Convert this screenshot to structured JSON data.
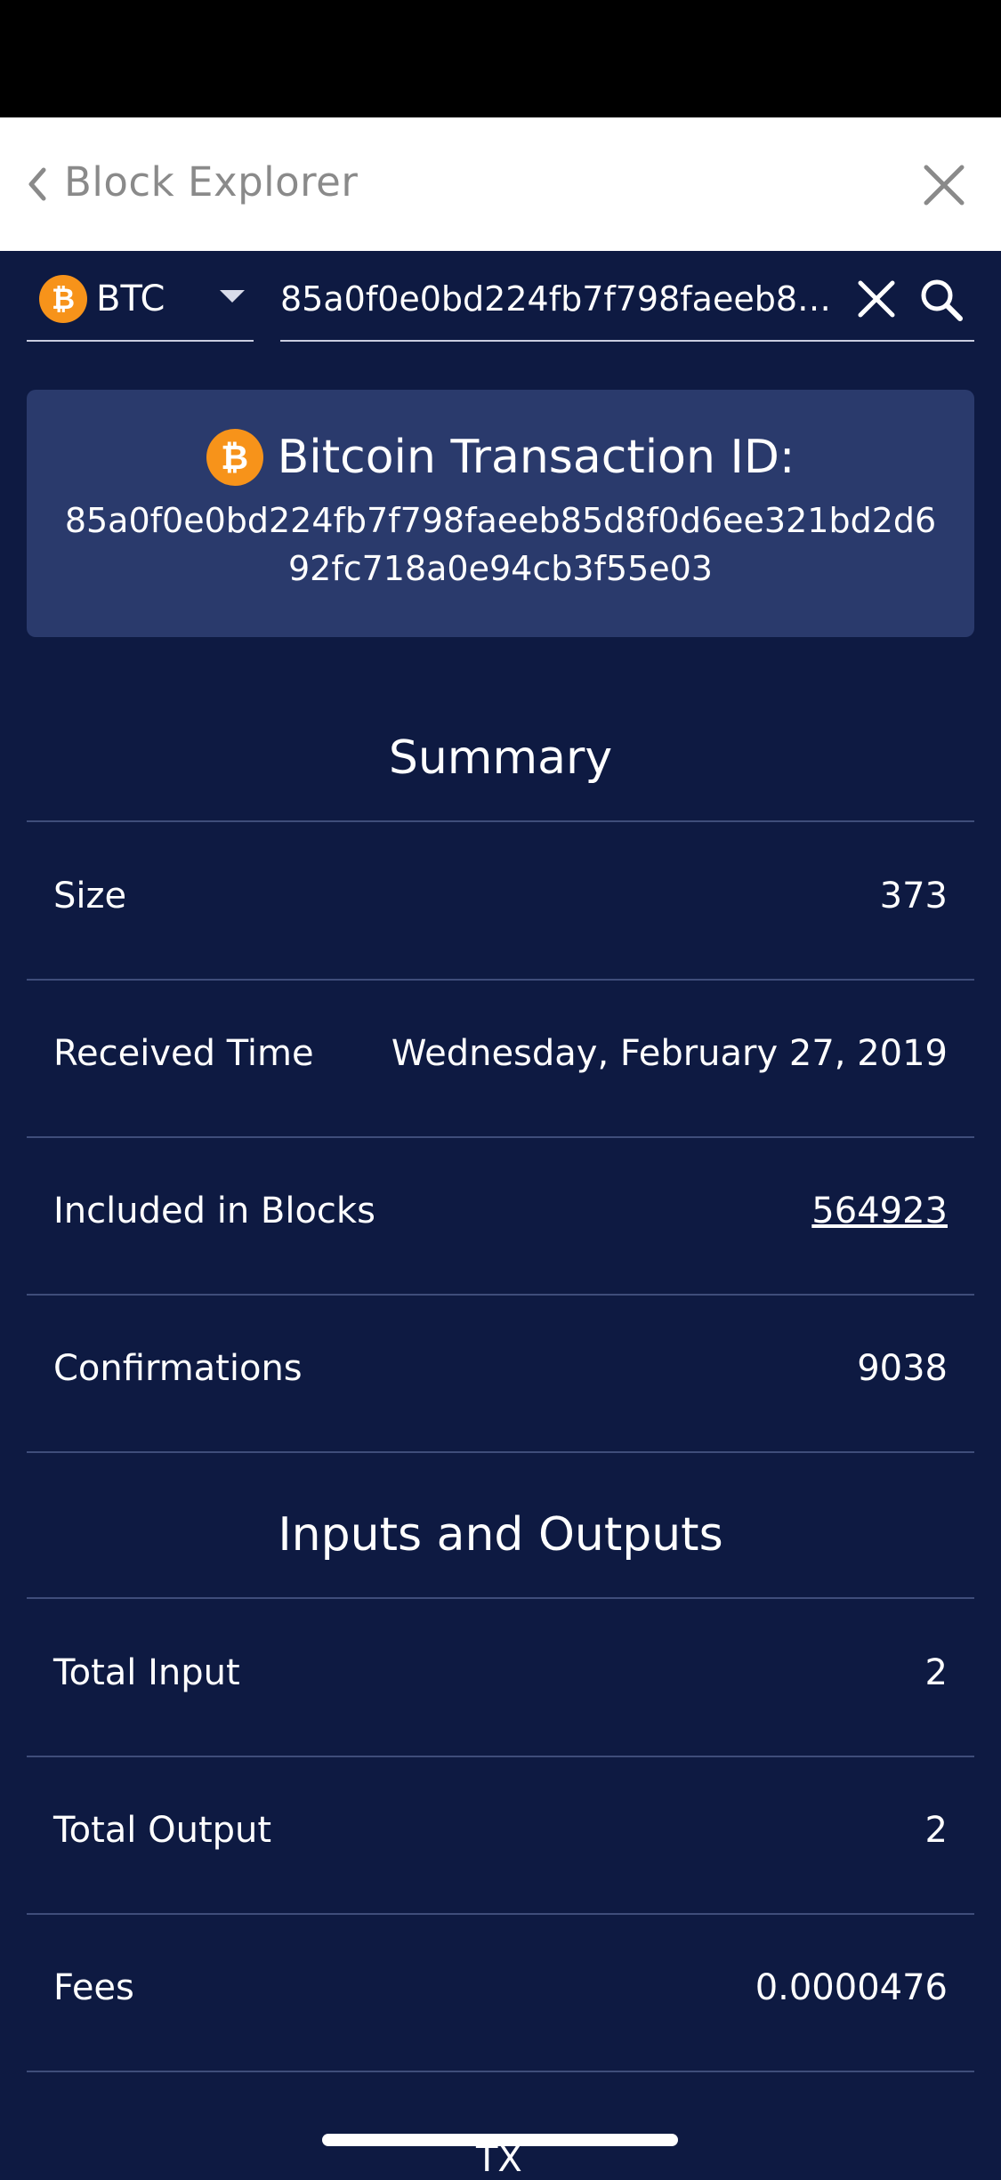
{
  "header": {
    "title": "Block Explorer"
  },
  "search": {
    "currency": "BTC",
    "coin_symbol": "₿",
    "query": "85a0f0e0bd224fb7f798faeeb85d8f0d6ee321bd2d692fc718a0e94cb3f55e03",
    "query_display": "85a0f0e0bd224fb7f798faeeb85..."
  },
  "txid_card": {
    "title": "Bitcoin Transaction ID:",
    "value": "85a0f0e0bd224fb7f798faeeb85d8f0d6ee321bd2d692fc718a0e94cb3f55e03"
  },
  "summary": {
    "title": "Summary",
    "rows": [
      {
        "label": "Size",
        "value": "373"
      },
      {
        "label": "Received Time",
        "value": "Wednesday, February 27, 2019"
      },
      {
        "label": "Included in Blocks",
        "value": "564923"
      },
      {
        "label": "Confirmations",
        "value": "9038"
      }
    ]
  },
  "io": {
    "title": "Inputs and Outputs",
    "rows": [
      {
        "label": "Total Input",
        "value": "2"
      },
      {
        "label": "Total Output",
        "value": "2"
      },
      {
        "label": "Fees",
        "value": "0.0000476"
      }
    ]
  },
  "footer": {
    "partial_text": "TX"
  },
  "colors": {
    "background": "#0e1a42",
    "card": "#2a3a6c",
    "bitcoin": "#f7931a"
  }
}
